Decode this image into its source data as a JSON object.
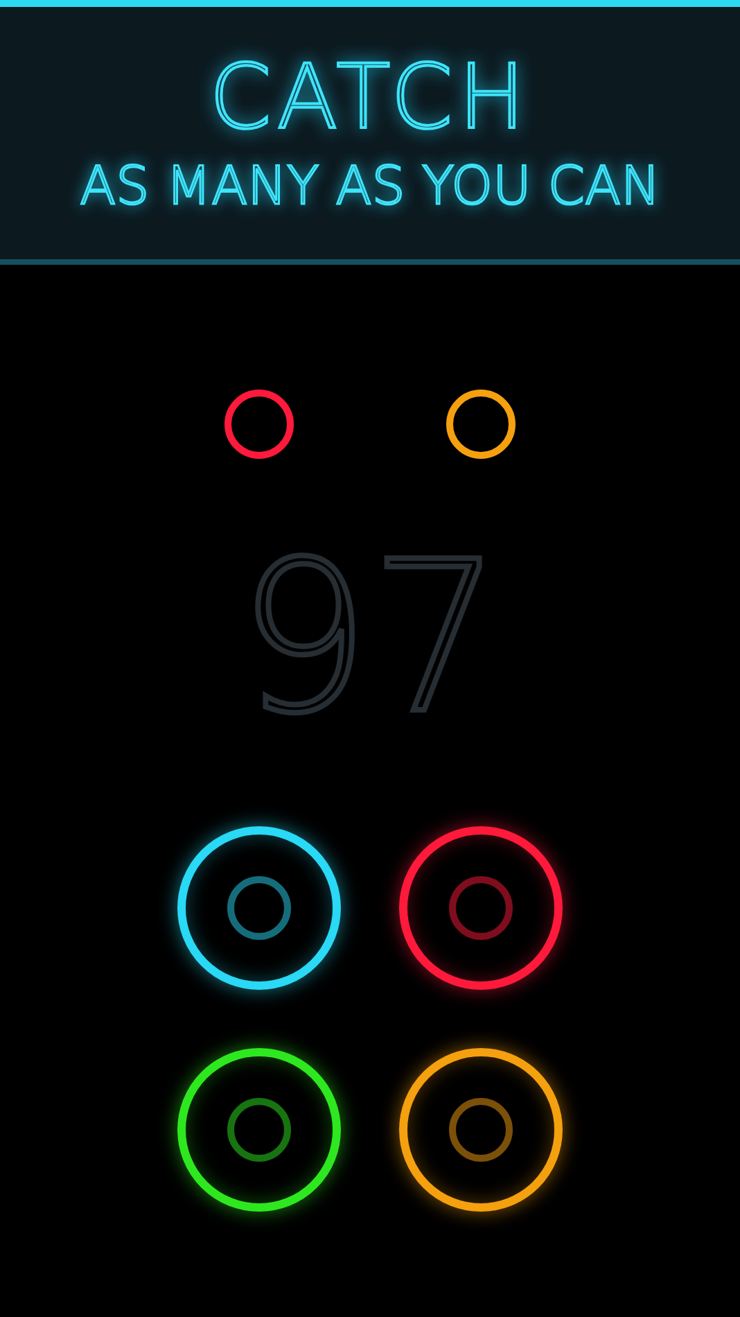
{
  "header": {
    "title": "CATCH",
    "subtitle": "AS MANY AS YOU CAN"
  },
  "falling_balls": [
    {
      "color": "#ff1a3c"
    },
    {
      "color": "#f5a00f"
    }
  ],
  "score": "97",
  "catch_buttons": [
    {
      "color": "#29d9f5"
    },
    {
      "color": "#ff1a3c"
    },
    {
      "color": "#2ee81f"
    },
    {
      "color": "#f5a00f"
    }
  ]
}
